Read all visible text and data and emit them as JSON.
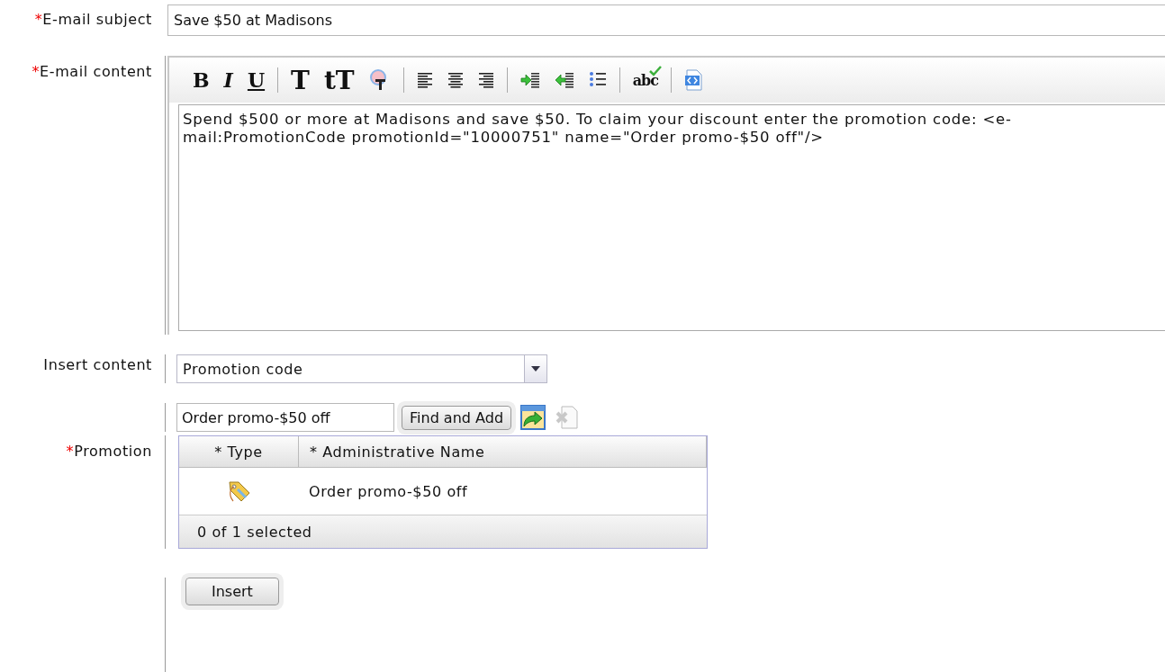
{
  "subject": {
    "required_mark": "*",
    "label": "E-mail subject",
    "value": "Save $50 at Madisons"
  },
  "content": {
    "required_mark": "*",
    "label": "E-mail content",
    "toolbar": [
      {
        "kind": "bold",
        "text": "B"
      },
      {
        "kind": "italic",
        "text": "I"
      },
      {
        "kind": "underline",
        "text": "U"
      },
      {
        "kind": "separator"
      },
      {
        "kind": "big",
        "text": "T"
      },
      {
        "kind": "big",
        "text": "tT"
      },
      {
        "kind": "color"
      },
      {
        "kind": "separator"
      },
      {
        "kind": "alignleft"
      },
      {
        "kind": "aligncenter"
      },
      {
        "kind": "alignright"
      },
      {
        "kind": "separator"
      },
      {
        "kind": "indent"
      },
      {
        "kind": "outdent"
      },
      {
        "kind": "bullets"
      },
      {
        "kind": "separator"
      },
      {
        "kind": "spelling",
        "text": "abc"
      },
      {
        "kind": "separator"
      },
      {
        "kind": "source"
      }
    ],
    "lines": [
      "Spend $500 or more at Madisons and save $50. To claim your discount enter the promotion code:  <e-",
      "mail:PromotionCode promotionId=\"10000751\" name=\"Order promo-$50 off\"/>"
    ]
  },
  "insert_content": {
    "label": "Insert content",
    "value": "Promotion code"
  },
  "search": {
    "value": "Order promo-$50 off",
    "button": "Find and Add"
  },
  "promotion": {
    "required_mark": "*",
    "label": "Promotion",
    "columns": [
      "* Type",
      "* Administrative Name"
    ],
    "rows": [
      {
        "name": "Order promo-$50 off"
      }
    ],
    "footer": "0 of 1 selected"
  },
  "insert_button": "Insert"
}
